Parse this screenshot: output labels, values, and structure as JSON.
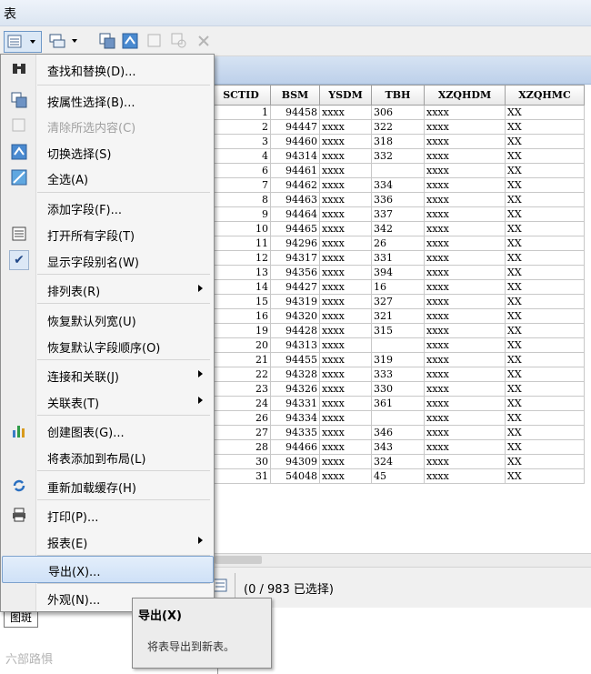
{
  "window": {
    "title": "表"
  },
  "table": {
    "columns": [
      "SCTID",
      "BSM",
      "YSDM",
      "TBH",
      "XZQHDM",
      "XZQHMC"
    ],
    "rows": [
      [
        "1",
        "94458",
        "xxxx",
        "306",
        "xxxx",
        "XX"
      ],
      [
        "2",
        "94447",
        "xxxx",
        "322",
        "xxxx",
        "XX"
      ],
      [
        "3",
        "94460",
        "xxxx",
        "318",
        "xxxx",
        "XX"
      ],
      [
        "4",
        "94314",
        "xxxx",
        "332",
        "xxxx",
        "XX"
      ],
      [
        "6",
        "94461",
        "xxxx",
        "",
        "xxxx",
        "XX"
      ],
      [
        "7",
        "94462",
        "xxxx",
        "334",
        "xxxx",
        "XX"
      ],
      [
        "8",
        "94463",
        "xxxx",
        "336",
        "xxxx",
        "XX"
      ],
      [
        "9",
        "94464",
        "xxxx",
        "337",
        "xxxx",
        "XX"
      ],
      [
        "10",
        "94465",
        "xxxx",
        "342",
        "xxxx",
        "XX"
      ],
      [
        "11",
        "94296",
        "xxxx",
        "26",
        "xxxx",
        "XX"
      ],
      [
        "12",
        "94317",
        "xxxx",
        "331",
        "xxxx",
        "XX"
      ],
      [
        "13",
        "94356",
        "xxxx",
        "394",
        "xxxx",
        "XX"
      ],
      [
        "14",
        "94427",
        "xxxx",
        "16",
        "xxxx",
        "XX"
      ],
      [
        "15",
        "94319",
        "xxxx",
        "327",
        "xxxx",
        "XX"
      ],
      [
        "16",
        "94320",
        "xxxx",
        "321",
        "xxxx",
        "XX"
      ],
      [
        "19",
        "94428",
        "xxxx",
        "315",
        "xxxx",
        "XX"
      ],
      [
        "20",
        "94313",
        "xxxx",
        "",
        "xxxx",
        "XX"
      ],
      [
        "21",
        "94455",
        "xxxx",
        "319",
        "xxxx",
        "XX"
      ],
      [
        "22",
        "94328",
        "xxxx",
        "333",
        "xxxx",
        "XX"
      ],
      [
        "23",
        "94326",
        "xxxx",
        "330",
        "xxxx",
        "XX"
      ],
      [
        "24",
        "94331",
        "xxxx",
        "361",
        "xxxx",
        "XX"
      ],
      [
        "26",
        "94334",
        "xxxx",
        "",
        "xxxx",
        "XX"
      ],
      [
        "27",
        "94335",
        "xxxx",
        "346",
        "xxxx",
        "XX"
      ],
      [
        "28",
        "94466",
        "xxxx",
        "343",
        "xxxx",
        "XX"
      ],
      [
        "30",
        "94309",
        "xxxx",
        "324",
        "xxxx",
        "XX"
      ],
      [
        "31",
        "54048",
        "xxxx",
        "45",
        "xxxx",
        "XX"
      ]
    ]
  },
  "status": {
    "selection": "(0 / 983 已选择)"
  },
  "bottom_tab": {
    "label": "图斑"
  },
  "watermark": "六部路惧",
  "menu": {
    "items": [
      {
        "label": "查找和替换(D)...",
        "icon": "binoculars-icon"
      },
      {
        "label": "按属性选择(B)...",
        "icon": "select-by-attributes-icon"
      },
      {
        "label": "清除所选内容(C)",
        "icon": "clear-selection-icon",
        "disabled": true
      },
      {
        "label": "切换选择(S)",
        "icon": "switch-selection-icon"
      },
      {
        "label": "全选(A)",
        "icon": "select-all-icon"
      },
      {
        "label": "添加字段(F)..."
      },
      {
        "label": "打开所有字段(T)",
        "icon": "field-list-icon"
      },
      {
        "label": "显示字段别名(W)",
        "icon": "checkmark-icon",
        "checked": true
      },
      {
        "label": "排列表(R)",
        "submenu": true
      },
      {
        "label": "恢复默认列宽(U)"
      },
      {
        "label": "恢复默认字段顺序(O)"
      },
      {
        "label": "连接和关联(J)",
        "submenu": true
      },
      {
        "label": "关联表(T)",
        "submenu": true
      },
      {
        "label": "创建图表(G)...",
        "icon": "bar-chart-icon"
      },
      {
        "label": "将表添加到布局(L)"
      },
      {
        "label": "重新加载缓存(H)",
        "icon": "reload-icon"
      },
      {
        "label": "打印(P)...",
        "icon": "printer-icon"
      },
      {
        "label": "报表(E)",
        "submenu": true
      },
      {
        "label": "导出(X)...",
        "selected": true
      },
      {
        "label": "外观(N)..."
      }
    ]
  },
  "tooltip": {
    "title": "导出(X)",
    "description": "将表导出到新表。"
  }
}
